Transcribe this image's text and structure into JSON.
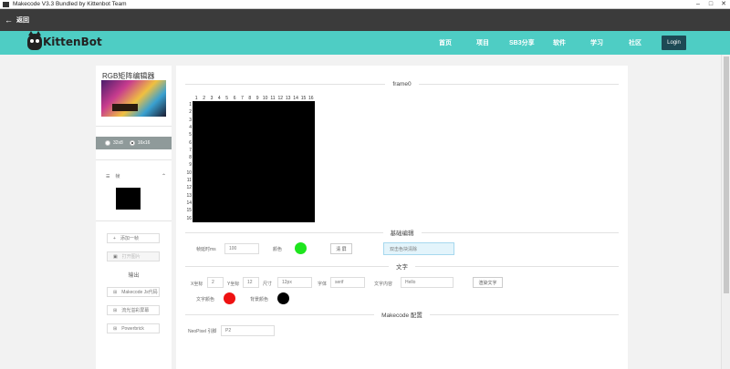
{
  "window": {
    "title": "Makecode V3.3 Bundled by Kittenbot Team"
  },
  "backbar": {
    "label": "返回"
  },
  "brand": {
    "logo_text": "KittenBot",
    "accent": "#4ecdc4",
    "dark": "#3b3b3b",
    "login_bg": "#1d4a55"
  },
  "nav": {
    "items": [
      "首页",
      "项目",
      "SB3分享",
      "软件",
      "学习",
      "社区"
    ],
    "login": "Login"
  },
  "sidebar": {
    "title": "RGB矩阵编辑器",
    "size_options": [
      "32x8",
      "16x16"
    ],
    "selected_size": "16x16",
    "frames_label": "帧",
    "add_frame": "添加一帧",
    "open_image": "打开图片",
    "output_label": "输出",
    "outputs": [
      "Makecode Js代码",
      "流光溢彩屏幕",
      "Powerbrick"
    ]
  },
  "main": {
    "frame_title": "frame0",
    "columns": [
      "1",
      "2",
      "3",
      "4",
      "5",
      "6",
      "7",
      "8",
      "9",
      "10",
      "11",
      "12",
      "13",
      "14",
      "15",
      "16"
    ],
    "rows": [
      "1",
      "2",
      "3",
      "4",
      "5",
      "6",
      "7",
      "8",
      "9",
      "10",
      "11",
      "12",
      "13",
      "14",
      "15",
      "16"
    ],
    "basic_edit": {
      "title": "基础编辑",
      "frame_delay_label": "帧延时ms",
      "frame_delay_value": "100",
      "color_label": "颜色",
      "color_value": "#1ee51e",
      "clear_button": "清 屏",
      "fill_input": "双击色块清除"
    },
    "text": {
      "title": "文字",
      "x_label": "X坐标",
      "x_value": "2",
      "y_label": "Y坐标",
      "y_value": "12",
      "size_label": "尺寸",
      "size_value": "12px",
      "font_label": "字体",
      "font_value": "serif",
      "content_label": "文字内容",
      "content_value": "Hello",
      "render_button": "渲染文字",
      "text_color_label": "文字颜色",
      "text_color_value": "#ee1111",
      "bg_color_label": "背景颜色",
      "bg_color_value": "#000000"
    },
    "makecode": {
      "title": "Makecode 配置",
      "pin_label": "NeoPixel 引脚",
      "pin_value": "P2"
    }
  }
}
